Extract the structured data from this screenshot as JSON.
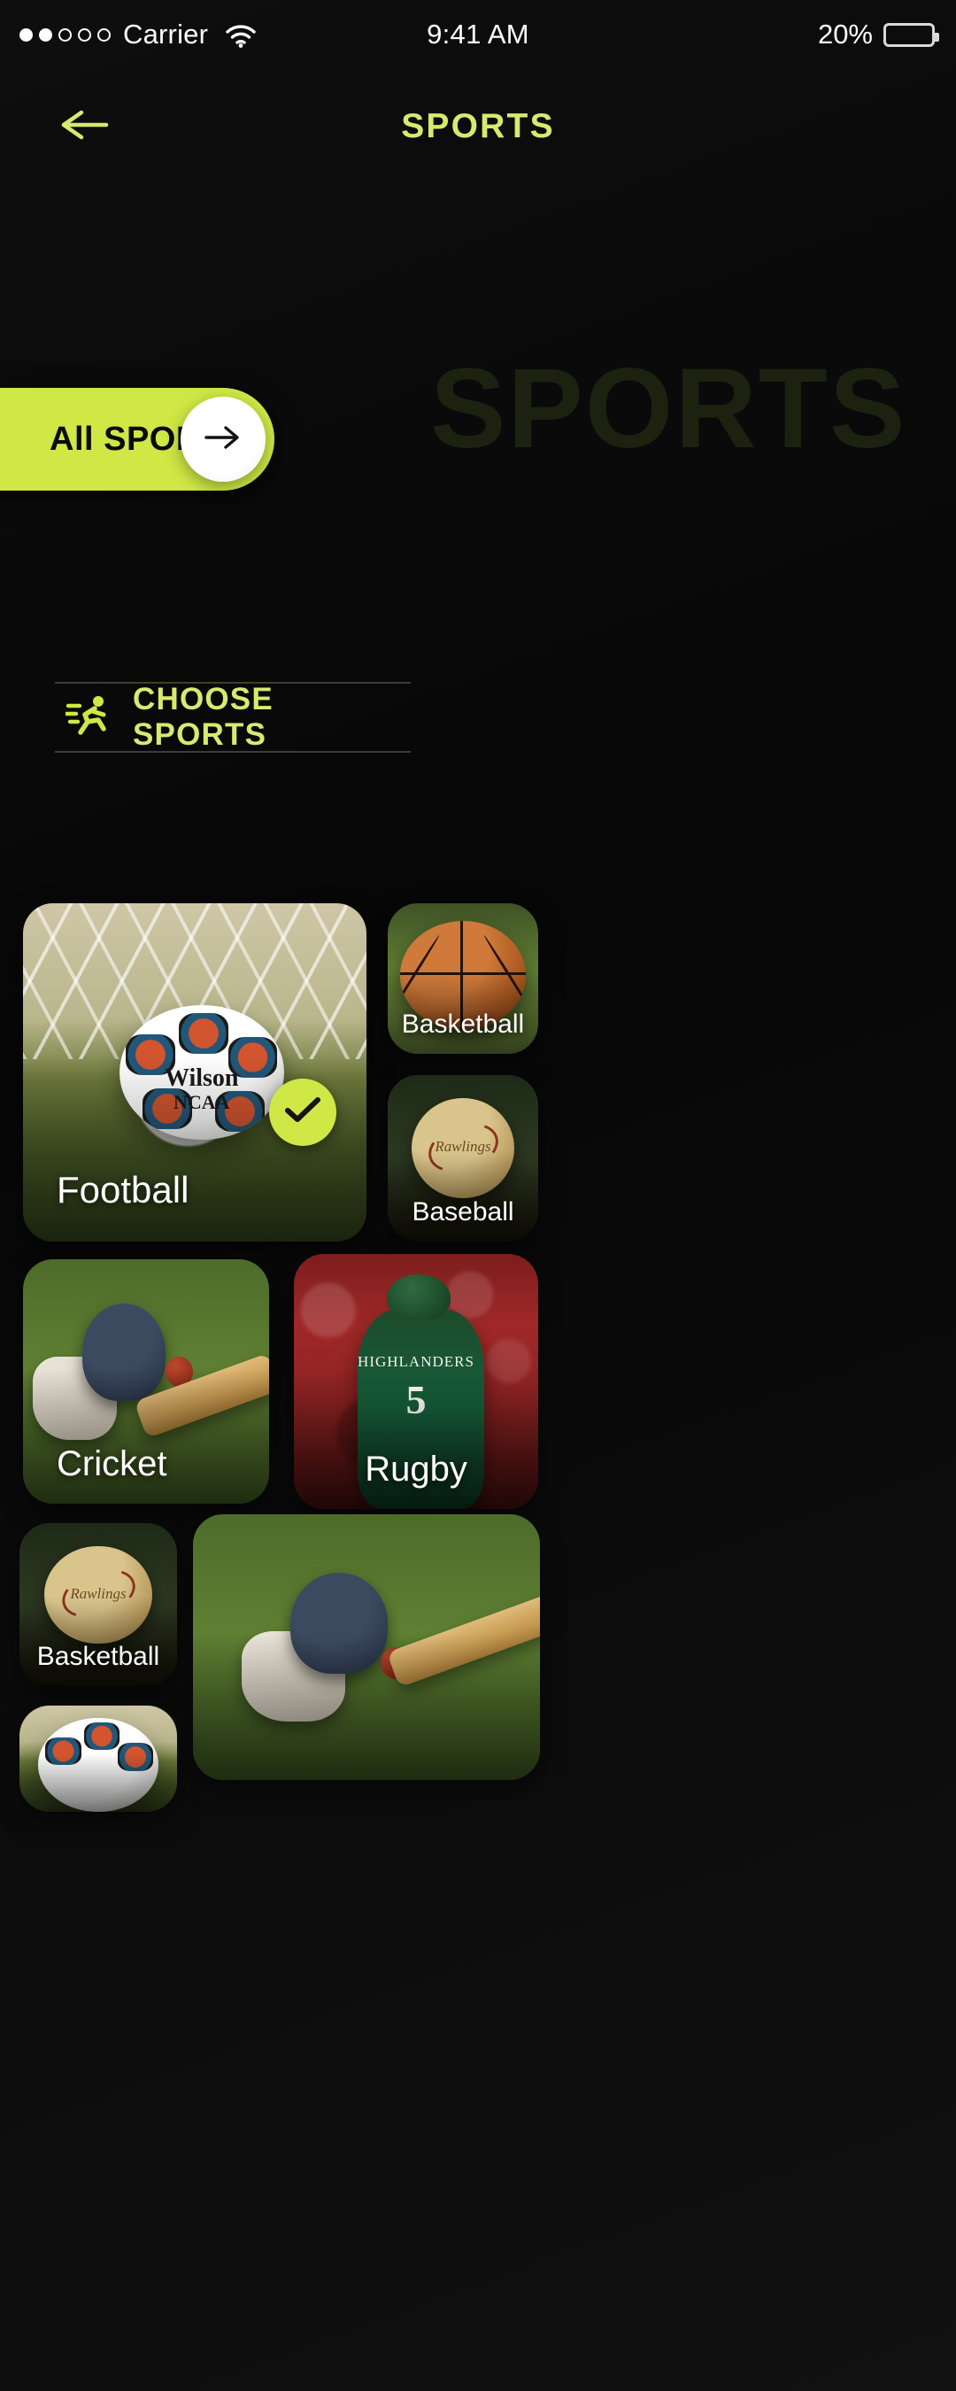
{
  "status_bar": {
    "carrier": "Carrier",
    "signal_filled": 2,
    "signal_total": 5,
    "wifi_icon": "wifi-icon",
    "time": "9:41 AM",
    "battery_percent": "20%",
    "battery_level": 20
  },
  "nav": {
    "back_icon": "arrow-left-icon",
    "title": "SPORTS"
  },
  "hero": {
    "watermark": "SPORTS",
    "pill_label": "All SPORTS",
    "pill_arrow_icon": "arrow-right-icon"
  },
  "section": {
    "icon": "running-person-icon",
    "title": "CHOOSE SPORTS"
  },
  "colors": {
    "accent_lime": "#cfe845",
    "accent_title": "#d7ea6e",
    "background": "#0b0b0b",
    "watermark": "#1d2110",
    "divider": "#3a3f2a",
    "card_label": "#ffffff"
  },
  "cards": [
    {
      "id": "football",
      "label": "Football",
      "selected": true,
      "check_icon": "check-icon"
    },
    {
      "id": "basketball",
      "label": "Basketball",
      "selected": false
    },
    {
      "id": "baseball",
      "label": "Baseball",
      "selected": false
    },
    {
      "id": "cricket",
      "label": "Cricket",
      "selected": false
    },
    {
      "id": "rugby",
      "label": "Rugby",
      "selected": false
    },
    {
      "id": "basketball2",
      "label": "Basketball",
      "selected": false
    },
    {
      "id": "cricket2",
      "label": "",
      "selected": false
    },
    {
      "id": "football2",
      "label": "",
      "selected": false
    }
  ],
  "art_text": {
    "football_brand": "Wilson",
    "football_sub": "NCAA",
    "baseball_brand": "Rawlings",
    "baseball2_brand": "Rawlings",
    "rugby_team": "HIGHLANDERS",
    "rugby_number": "5"
  }
}
